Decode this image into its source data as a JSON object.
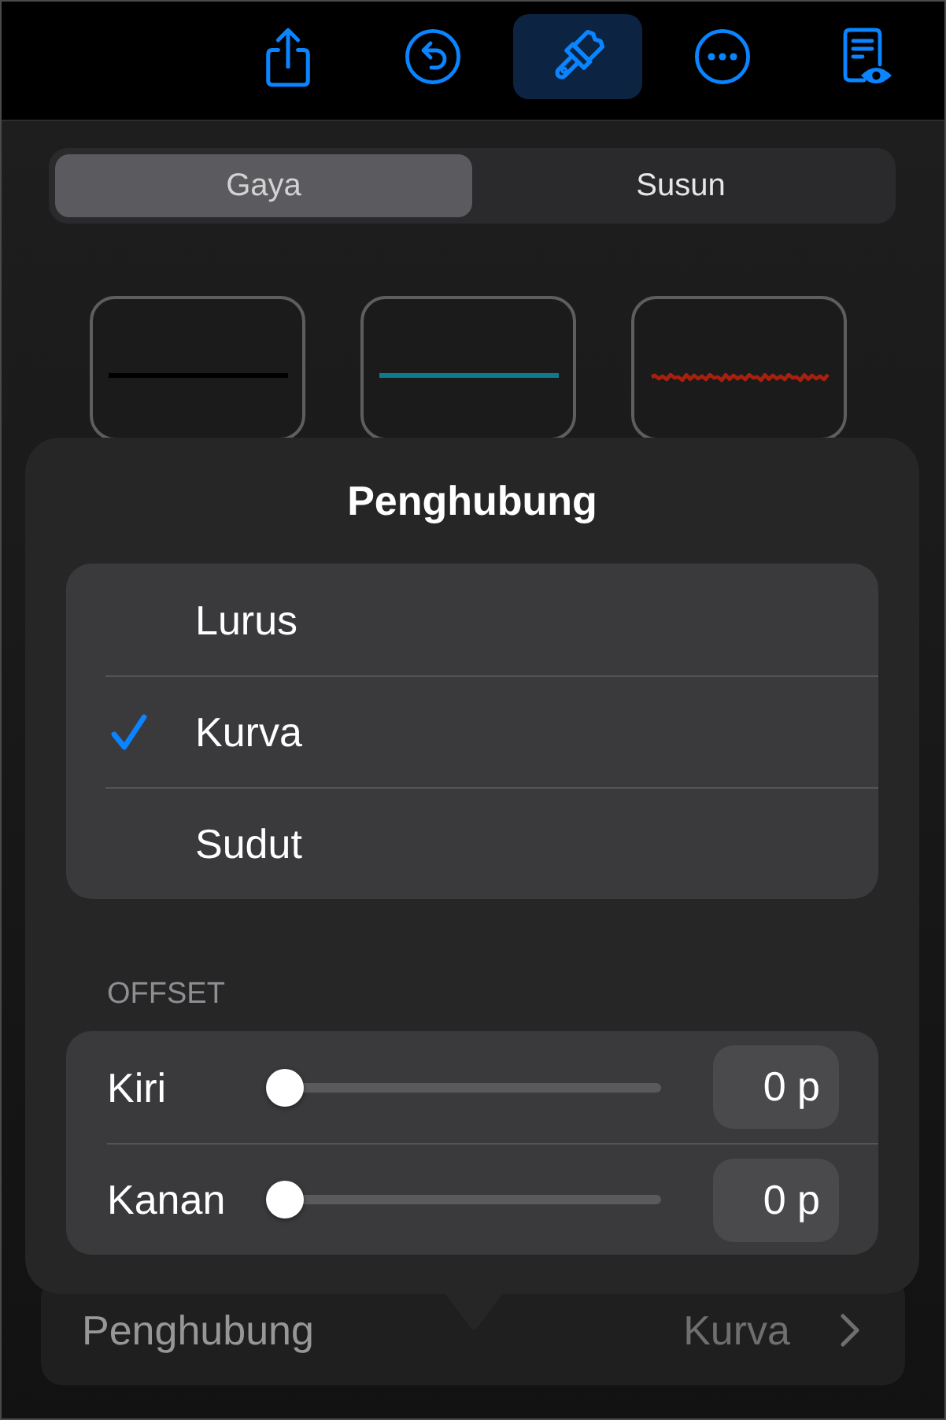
{
  "toolbar": {
    "buttons": [
      {
        "selected": false
      },
      {
        "selected": false
      },
      {
        "selected": true
      },
      {
        "selected": false
      },
      {
        "selected": false
      }
    ]
  },
  "segmented": {
    "segments": [
      {
        "label": "Gaya",
        "selected": true
      },
      {
        "label": "Susun",
        "selected": false
      }
    ]
  },
  "line_styles": [
    {
      "kind": "solid",
      "color": "#000000"
    },
    {
      "kind": "solid",
      "color": "#0e7a8f"
    },
    {
      "kind": "rough",
      "color": "#a8200e"
    }
  ],
  "popover": {
    "title": "Penghubung",
    "options": [
      {
        "label": "Lurus",
        "selected": false
      },
      {
        "label": "Kurva",
        "selected": true
      },
      {
        "label": "Sudut",
        "selected": false
      }
    ],
    "offset": {
      "heading": "OFFSET",
      "sliders": [
        {
          "label": "Kiri",
          "level": 0,
          "value": "0 p"
        },
        {
          "label": "Kanan",
          "level": 0,
          "value": "0 p"
        }
      ]
    }
  },
  "setting_row": {
    "label": "Penghubung",
    "value": "Kurva"
  }
}
